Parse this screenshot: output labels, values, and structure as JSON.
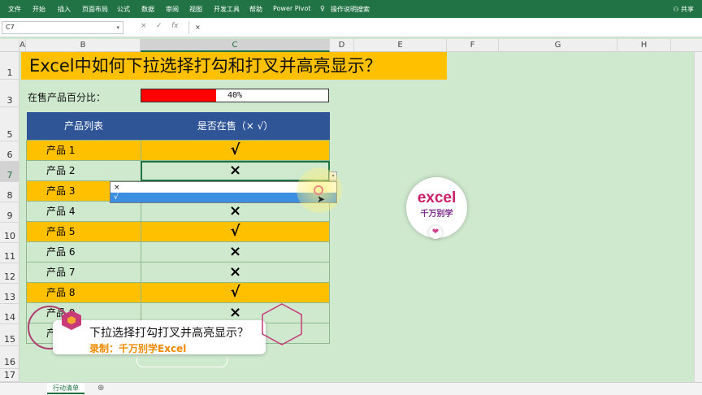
{
  "ribbon": {
    "tabs": [
      "文件",
      "开始",
      "插入",
      "页面布局",
      "公式",
      "数据",
      "审阅",
      "视图",
      "开发工具",
      "帮助",
      "Power Pivot",
      "操作说明搜索"
    ],
    "share": "共享"
  },
  "formula_bar": {
    "name_box": "C7",
    "cancel": "×",
    "enter": "✓",
    "fx": "fx",
    "content": "×"
  },
  "columns": [
    "A",
    "B",
    "C",
    "D",
    "E",
    "F",
    "G",
    "H"
  ],
  "rows": [
    "1",
    "3",
    "5",
    "6",
    "7",
    "8",
    "9",
    "10",
    "11",
    "12",
    "13",
    "14",
    "15",
    "16",
    "17"
  ],
  "title": "Excel中如何下拉选择打勾和打叉并高亮显示？",
  "progress": {
    "label": "在售产品百分比：",
    "value": 0.4,
    "text": "40%",
    "fill_color": "#ff0000"
  },
  "table": {
    "headers": [
      "产品列表",
      "是否在售（× √）"
    ],
    "rows": [
      {
        "name": "产品  1",
        "status": "√",
        "highlight": true
      },
      {
        "name": "产品  2",
        "status": "×",
        "highlight": false
      },
      {
        "name": "产品  3",
        "status": "",
        "highlight": true
      },
      {
        "name": "产品  4",
        "status": "×",
        "highlight": false
      },
      {
        "name": "产品  5",
        "status": "√",
        "highlight": true
      },
      {
        "name": "产品  6",
        "status": "×",
        "highlight": false
      },
      {
        "name": "产品  7",
        "status": "×",
        "highlight": false
      },
      {
        "name": "产品  8",
        "status": "√",
        "highlight": true
      },
      {
        "name": "产品  9",
        "status": "×",
        "highlight": false
      },
      {
        "name": "产品  10",
        "status": "",
        "highlight": false
      }
    ],
    "highlight_color": "#ffc000",
    "header_color": "#2f5597"
  },
  "dropdown": {
    "options": [
      "×",
      "√"
    ],
    "highlighted_index": 1
  },
  "logo": {
    "main": "excel",
    "sub": "千万别学",
    "heart": "❤"
  },
  "caption": {
    "line1": "下拉选择打勾打叉并高亮显示？",
    "line2": "录制：千万别学Excel"
  },
  "sheet": {
    "tab": "行动清单",
    "add": "⊕"
  },
  "accent_color": "#217346"
}
